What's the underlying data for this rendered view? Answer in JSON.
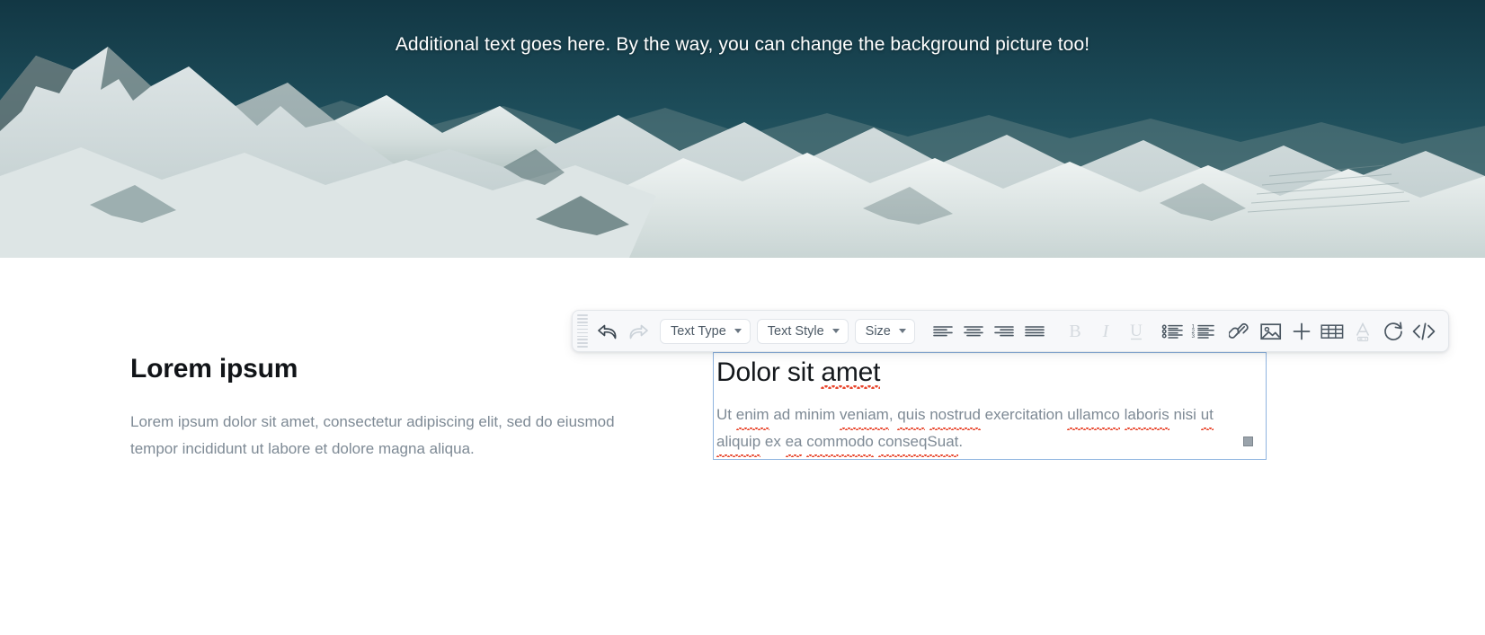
{
  "hero": {
    "text": "Additional text goes here. By the way, you can change the background picture too!",
    "sky_color": "#1d4b58",
    "snow_color": "#e8eced",
    "rock_color": "#2f4f52"
  },
  "left_column": {
    "heading": "Lorem ipsum",
    "paragraph": "Lorem ipsum dolor sit amet, consectetur adipiscing elit, sed do eiusmod tempor incididunt ut labore et dolore magna aliqua."
  },
  "editor": {
    "selected": true,
    "border_color": "#8fb4e0",
    "heading_prefix": "Dolor sit ",
    "heading_misspelled": "amet",
    "body": [
      {
        "t": "Ut ",
        "m": false
      },
      {
        "t": "enim",
        "m": true
      },
      {
        "t": " ad minim ",
        "m": false
      },
      {
        "t": "veniam",
        "m": true
      },
      {
        "t": ", ",
        "m": false
      },
      {
        "t": "quis",
        "m": true
      },
      {
        "t": " ",
        "m": false
      },
      {
        "t": "nostrud",
        "m": true
      },
      {
        "t": " exercitation ",
        "m": false
      },
      {
        "t": "ullamco",
        "m": true
      },
      {
        "t": " ",
        "m": false
      },
      {
        "t": "laboris",
        "m": true
      },
      {
        "t": " nisi ",
        "m": false
      },
      {
        "t": "ut",
        "m": true
      },
      {
        "t": " ",
        "m": false
      },
      {
        "t": "aliquip",
        "m": true
      },
      {
        "t": " ex ",
        "m": false
      },
      {
        "t": "ea",
        "m": true
      },
      {
        "t": " ",
        "m": false
      },
      {
        "t": "commodo",
        "m": true
      },
      {
        "t": " ",
        "m": false
      },
      {
        "t": "conseqSuat",
        "m": true
      },
      {
        "t": ".",
        "m": false
      }
    ],
    "spellcheck_color": "#e8452c",
    "resize_handle": "resize-handle"
  },
  "toolbar": {
    "drag_handle": "drag-handle",
    "undo": {
      "label": "Undo",
      "icon": "undo-arrow-icon",
      "enabled": true
    },
    "redo": {
      "label": "Redo",
      "icon": "redo-arrow-icon",
      "enabled": false
    },
    "selects": [
      {
        "label": "Text Type",
        "name": "text-type-select"
      },
      {
        "label": "Text Style",
        "name": "text-style-select"
      },
      {
        "label": "Size",
        "name": "size-select"
      }
    ],
    "buttons": [
      {
        "name": "align-left-button",
        "icon": "align-left-icon",
        "enabled": true
      },
      {
        "name": "align-center-button",
        "icon": "align-center-icon",
        "enabled": true
      },
      {
        "name": "align-right-button",
        "icon": "align-right-icon",
        "enabled": true
      },
      {
        "name": "align-justify-button",
        "icon": "align-justify-icon",
        "enabled": true
      },
      {
        "name": "bold-button",
        "icon": "bold-icon",
        "enabled": false,
        "glyph": "B"
      },
      {
        "name": "italic-button",
        "icon": "italic-icon",
        "enabled": false,
        "glyph": "I"
      },
      {
        "name": "underline-button",
        "icon": "underline-icon",
        "enabled": false,
        "glyph": "U"
      },
      {
        "name": "bullet-list-button",
        "icon": "bullet-list-icon",
        "enabled": true
      },
      {
        "name": "numbered-list-button",
        "icon": "numbered-list-icon",
        "enabled": true
      },
      {
        "name": "link-button",
        "icon": "link-icon",
        "enabled": true
      },
      {
        "name": "image-button",
        "icon": "image-icon",
        "enabled": true
      },
      {
        "name": "add-button",
        "icon": "plus-icon",
        "enabled": true
      },
      {
        "name": "table-button",
        "icon": "table-icon",
        "enabled": true
      },
      {
        "name": "font-color-button",
        "icon": "font-color-a-icon",
        "enabled": false
      },
      {
        "name": "refresh-button",
        "icon": "refresh-circle-icon",
        "enabled": true
      },
      {
        "name": "code-view-button",
        "icon": "code-brackets-icon",
        "enabled": true
      }
    ]
  }
}
